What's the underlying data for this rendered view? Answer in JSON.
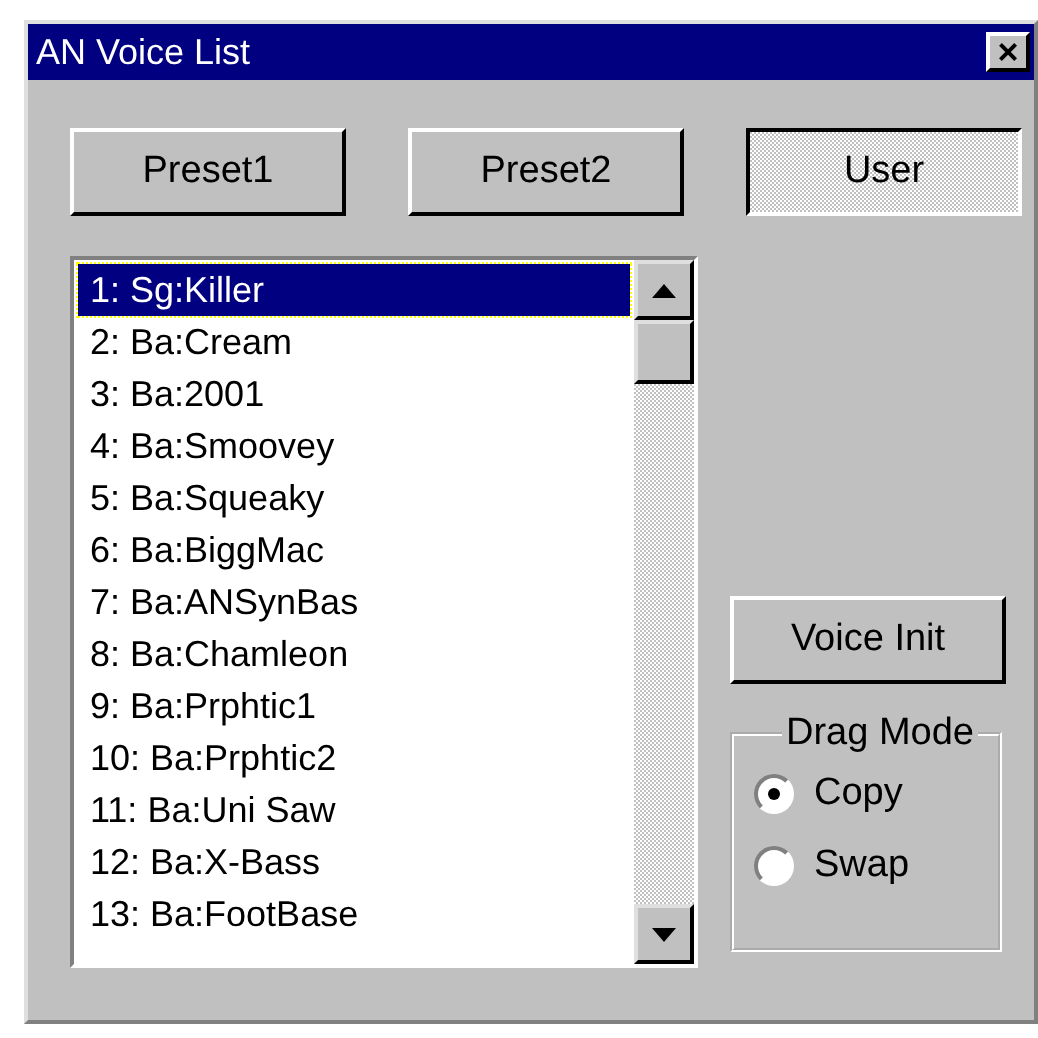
{
  "window": {
    "title": "AN Voice List",
    "close": "×"
  },
  "banks": [
    {
      "label": "Preset1",
      "selected": false
    },
    {
      "label": "Preset2",
      "selected": false
    },
    {
      "label": "User",
      "selected": true
    }
  ],
  "voices": [
    {
      "label": "1: Sg:Killer",
      "selected": true
    },
    {
      "label": "2: Ba:Cream",
      "selected": false
    },
    {
      "label": "3: Ba:2001",
      "selected": false
    },
    {
      "label": "4: Ba:Smoovey",
      "selected": false
    },
    {
      "label": "5: Ba:Squeaky",
      "selected": false
    },
    {
      "label": "6: Ba:BiggMac",
      "selected": false
    },
    {
      "label": "7: Ba:ANSynBas",
      "selected": false
    },
    {
      "label": "8: Ba:Chamleon",
      "selected": false
    },
    {
      "label": "9: Ba:Prphtic1",
      "selected": false
    },
    {
      "label": "10: Ba:Prphtic2",
      "selected": false
    },
    {
      "label": "11: Ba:Uni Saw",
      "selected": false
    },
    {
      "label": "12: Ba:X-Bass",
      "selected": false
    },
    {
      "label": "13: Ba:FootBase",
      "selected": false
    }
  ],
  "voice_init": "Voice Init",
  "drag_mode": {
    "title": "Drag Mode",
    "options": [
      {
        "label": "Copy",
        "selected": true
      },
      {
        "label": "Swap",
        "selected": false
      }
    ]
  }
}
